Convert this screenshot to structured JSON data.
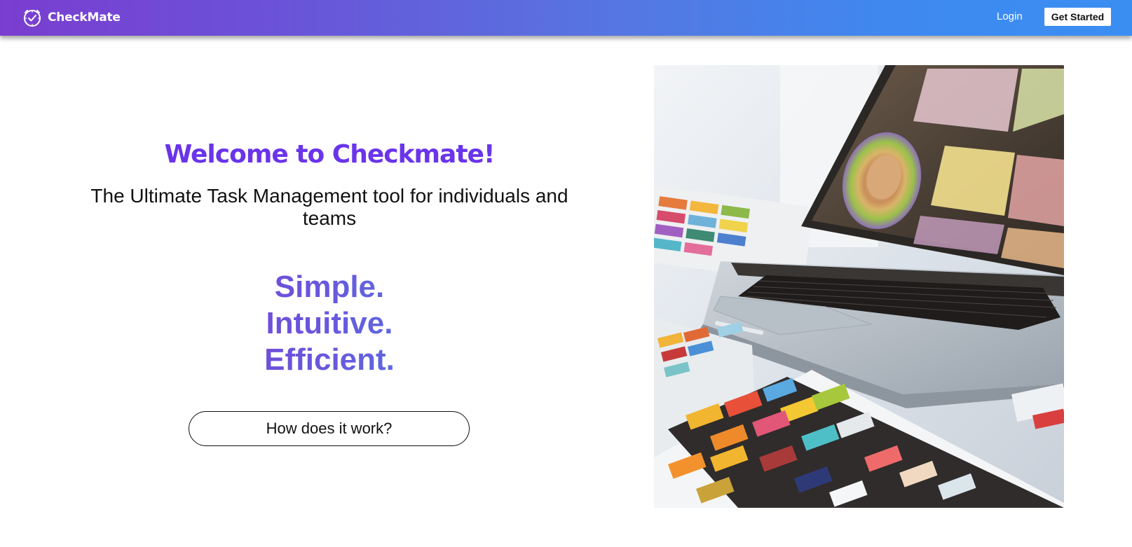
{
  "navbar": {
    "brand": "CheckMate",
    "login_label": "Login",
    "cta_label": "Get Started",
    "brand_icon": "clock-check-icon"
  },
  "hero": {
    "title": "Welcome to Checkmate!",
    "subtitle": "The Ultimate Task Management tool for individuals and teams",
    "tagline": [
      "Simple.",
      "Intuitive.",
      "Efficient."
    ],
    "how_button_label": "How does it work?",
    "image_subject": "laptop-with-color-swatches"
  },
  "colors": {
    "nav_gradient_start": "#7a3dd0",
    "nav_gradient_end": "#3a8ef2",
    "title": "#6a34ea",
    "tagline_start": "#7a3fd6",
    "tagline_end": "#4f7fe6"
  }
}
